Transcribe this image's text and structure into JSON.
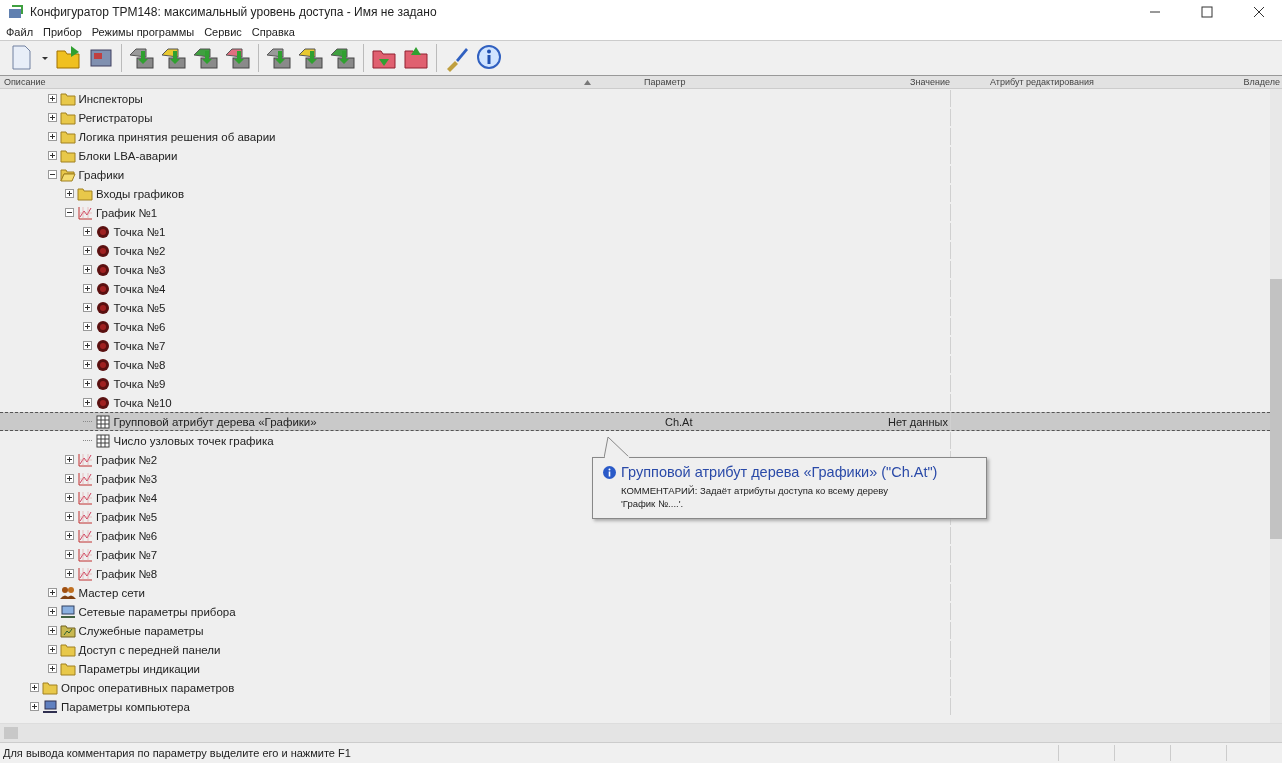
{
  "window": {
    "title": "Конфигуратор ТРМ148: максимальный уровень доступа - Имя не задано"
  },
  "menu": [
    "Файл",
    "Прибор",
    "Режимы программы",
    "Сервис",
    "Справка"
  ],
  "columns": [
    "Описание",
    "Параметр",
    "Значение",
    "Атрибут редактирования",
    "Владеле"
  ],
  "tree": {
    "items_under_scrolled_parent": [
      {
        "label": "Инспекторы",
        "kind": "folder",
        "expanded": false,
        "selected": false
      },
      {
        "label": "Регистраторы",
        "kind": "folder",
        "expanded": false,
        "selected": false
      },
      {
        "label": "Логика принятия решения об аварии",
        "kind": "folder",
        "expanded": false,
        "selected": false
      },
      {
        "label": "Блоки LBA-аварии",
        "kind": "folder",
        "expanded": false,
        "selected": false
      },
      {
        "label": "Графики",
        "kind": "folder",
        "expanded": true,
        "selected": false,
        "children": [
          {
            "label": "Входы графиков",
            "kind": "folder",
            "expanded": false,
            "selected": false
          },
          {
            "label": "График №1",
            "kind": "chart",
            "expanded": true,
            "selected": false,
            "children": [
              {
                "label": "Точка №1",
                "kind": "point",
                "expanded": false,
                "selected": false
              },
              {
                "label": "Точка №2",
                "kind": "point",
                "expanded": false,
                "selected": false
              },
              {
                "label": "Точка №3",
                "kind": "point",
                "expanded": false,
                "selected": false
              },
              {
                "label": "Точка №4",
                "kind": "point",
                "expanded": false,
                "selected": false
              },
              {
                "label": "Точка №5",
                "kind": "point",
                "expanded": false,
                "selected": false
              },
              {
                "label": "Точка №6",
                "kind": "point",
                "expanded": false,
                "selected": false
              },
              {
                "label": "Точка №7",
                "kind": "point",
                "expanded": false,
                "selected": false
              },
              {
                "label": "Точка №8",
                "kind": "point",
                "expanded": false,
                "selected": false
              },
              {
                "label": "Точка №9",
                "kind": "point",
                "expanded": false,
                "selected": false
              },
              {
                "label": "Точка №10",
                "kind": "point",
                "expanded": false,
                "selected": false
              },
              {
                "label": "Групповой атрибут дерева «Графики»",
                "kind": "attribute",
                "selected": true,
                "parameter": "Ch.At",
                "value": "Нет данных"
              },
              {
                "label": "Число узловых точек графика",
                "kind": "attribute",
                "selected": false
              }
            ]
          },
          {
            "label": "График №2",
            "kind": "chart",
            "expanded": false,
            "selected": false
          },
          {
            "label": "График №3",
            "kind": "chart",
            "expanded": false,
            "selected": false
          },
          {
            "label": "График №4",
            "kind": "chart",
            "expanded": false,
            "selected": false
          },
          {
            "label": "График №5",
            "kind": "chart",
            "expanded": false,
            "selected": false
          },
          {
            "label": "График №6",
            "kind": "chart",
            "expanded": false,
            "selected": false
          },
          {
            "label": "График №7",
            "kind": "chart",
            "expanded": false,
            "selected": false
          },
          {
            "label": "График №8",
            "kind": "chart",
            "expanded": false,
            "selected": false
          }
        ]
      },
      {
        "label": "Мастер сети",
        "kind": "master",
        "expanded": false,
        "selected": false
      },
      {
        "label": "Сетевые параметры прибора",
        "kind": "network",
        "expanded": false,
        "selected": false
      },
      {
        "label": "Служебные параметры",
        "kind": "service",
        "expanded": false,
        "selected": false
      },
      {
        "label": "Доступ с передней панели",
        "kind": "folder",
        "expanded": false,
        "selected": false
      },
      {
        "label": "Параметры индикации",
        "kind": "folder",
        "expanded": false,
        "selected": false
      }
    ],
    "root_items": [
      {
        "label": "Опрос оперативных параметров",
        "kind": "folder",
        "expanded": false,
        "selected": false
      },
      {
        "label": "Параметры компьютера",
        "kind": "computer",
        "expanded": false,
        "selected": false
      }
    ]
  },
  "tooltip": {
    "title": "Групповой атрибут дерева «Графики» (\"Ch.At\")",
    "comment": "КОММЕНТАРИЙ: Задаёт атрибуты доступа ко всему дереву 'График №....'."
  },
  "status_bar": {
    "text": "Для вывода комментария по параметру выделите его и нажмите F1"
  }
}
